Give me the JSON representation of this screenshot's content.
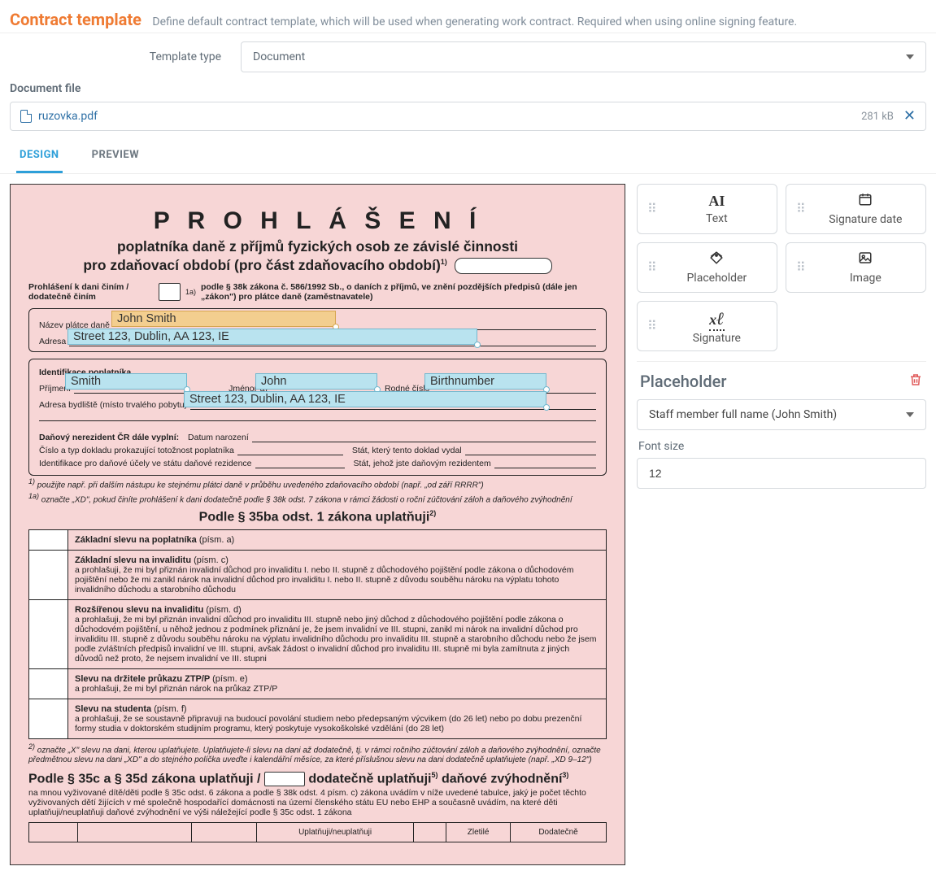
{
  "header": {
    "title": "Contract template",
    "subtitle": "Define default contract template, which will be used when generating work contract. Required when using online signing feature."
  },
  "template_row": {
    "label": "Template type",
    "value": "Document"
  },
  "docfile": {
    "label": "Document file",
    "name": "ruzovka.pdf",
    "size": "281 kB"
  },
  "tabs": {
    "design": "DESIGN",
    "preview": "PREVIEW"
  },
  "tools": {
    "text": {
      "icon": "AI",
      "label": "Text"
    },
    "sigdate": {
      "label": "Signature date"
    },
    "placeholder": {
      "label": "Placeholder"
    },
    "image": {
      "label": "Image"
    },
    "signature": {
      "label": "Signature"
    }
  },
  "panel": {
    "title": "Placeholder",
    "option": "Staff member full name (John Smith)",
    "fontsize_label": "Font size",
    "fontsize_value": "12"
  },
  "doc": {
    "title": "P R O H L Á Š E N Í",
    "sub1": "poplatníka daně z příjmů fyzických osob ze závislé činnosti",
    "sub2": "pro zdaňovací období (pro část zdaňovacího období)",
    "sup1": "1)",
    "declLine": "Prohlášení k dani činím / dodatečně činím",
    "declLaw": "podle § 38k zákona č. 586/1992 Sb., o daních z příjmů, ve znění pozdějších předpisů (dále jen „zákon\") pro plátce daně (zaměstnavatele)",
    "sup1a": "1a)",
    "b1": {
      "nazev": "Název plátce daně",
      "adresa": "Adresa"
    },
    "b2": {
      "id": "Identifikace poplatníka",
      "prij": "Příjmení",
      "jmeno": "Jméno(-a)",
      "rodne": "Rodné číslo",
      "bydl": "Adresa bydliště (místo trvalého pobytu)"
    },
    "nerez": "Daňový nerezident ČR dále vyplní:",
    "datnar": "Datum narození",
    "doklad": "Číslo a typ dokladu prokazující totožnost poplatníka",
    "statVydal": "Stát, který tento doklad vydal",
    "identDanove": "Identifikace pro daňové účely ve státu daňové rezidence",
    "statRez": "Stát, jehož jste daňovým rezidentem",
    "foot1": "použijte např. při dalším nástupu ke stejnému plátci daně v průběhu uvedeného zdaňovacího období (např. „od září RRRR\")",
    "foot1a": "označte „XD\", pokud činíte prohlášení k dani dodatečně podle § 38k odst. 7 zákona v rámci žádosti o roční zúčtování záloh a daňového zvýhodnění",
    "sec35ba": "Podle § 35ba odst. 1 zákona uplatňuji",
    "sup2": "2)",
    "rows35": [
      {
        "hd": "Základní slevu na poplatníka",
        "par": "(písm. a)",
        "body": ""
      },
      {
        "hd": "Základní slevu na invaliditu",
        "par": "(písm. c)",
        "body": "a prohlašuji, že mi byl přiznán invalidní důchod pro invaliditu I. nebo II. stupně z důchodového pojištění podle zákona o důchodovém pojištění nebo že mi zanikl nárok na invalidní důchod pro invaliditu I. nebo II. stupně z důvodu souběhu nároku na výplatu tohoto invalidního důchodu a starobního důchodu"
      },
      {
        "hd": "Rozšířenou slevu na invaliditu",
        "par": "(písm. d)",
        "body": "a prohlašuji, že mi byl přiznán invalidní důchod pro invaliditu III. stupně nebo jiný důchod z důchodového pojištění podle zákona o důchodovém pojištění, u něhož jednou z podmínek přiznání je, že jsem invalidní ve III. stupni, zanikl mi nárok na invalidní důchod pro invaliditu III. stupně z důvodu souběhu nároku na výplatu invalidního důchodu pro invaliditu III. stupně a starobního důchodu nebo že jsem podle zvláštních předpisů invalidní ve III. stupni, avšak žádost o invalidní důchod pro invaliditu III. stupně mi byla zamítnuta z jiných důvodů než proto, že nejsem invalidní ve III. stupni"
      },
      {
        "hd": "Slevu na držitele průkazu ZTP/P",
        "par": "(písm. e)",
        "body": "a prohlašuji, že mi byl přiznán nárok na průkaz ZTP/P"
      },
      {
        "hd": "Slevu na studenta",
        "par": "(písm. f)",
        "body": "a prohlašuji, že se soustavně připravuji na budoucí povolání studiem nebo předepsaným výcvikem (do 26 let) nebo po dobu prezenční formy studia v doktorském studijním programu, který poskytuje vysokoškolské vzdělání (do 28 let)"
      }
    ],
    "foot2": "označte „X\" slevu na dani, kterou uplatňujete. Uplatňujete-li slevu na dani až dodatečně, tj. v rámci ročního zúčtování záloh a daňového zvýhodnění, označte předmětnou slevu na dani „XD\" a do stejného políčka uveďte i kalendářní měsíce, za které příslušnou slevu na dani dodatečně uplatňujete (např. „XD 9–12\")",
    "sec35c": "Podle § 35c a § 35d zákona uplatňuji /",
    "sec35c2": "dodatečně uplatňuji",
    "sec35c3": "daňové zvýhodnění",
    "sup5": "5)",
    "sup3": "3)",
    "bodytext": "na mnou vyživované dítě/děti podle § 35c odst. 6 zákona a podle § 38k odst. 4 písm. c) zákona uvádím v níže uvedené tabulce, jaký je počet těchto vyživovaných dětí žijících v mé společně hospodařící domácnosti na území členského státu EU nebo EHP a současně uvádím, na které děti uplatňuji/neuplatňuji daňové zvýhodnění ve výši náležející podle § 35c odst. 1 zákona",
    "coltab": [
      "",
      "",
      "",
      "Uplatňuji/neuplatňuji",
      "",
      "Zletilé",
      "Dodatečně"
    ]
  },
  "overlays": {
    "fullname": "John Smith",
    "addr": "Street 123, Dublin, AA 123, IE",
    "surname": "Smith",
    "firstname": "John",
    "birthnum": "Birthnumber",
    "addr2": "Street 123, Dublin, AA 123, IE"
  }
}
